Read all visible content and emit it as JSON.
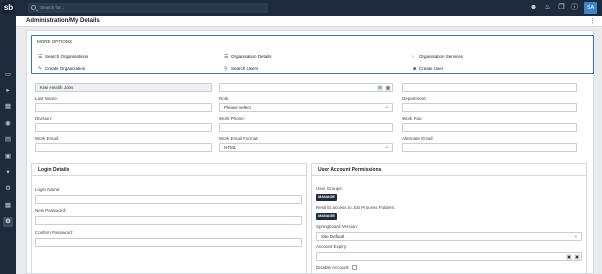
{
  "topbar": {
    "logo": "sb",
    "search_placeholder": "Search for...",
    "icons": [
      "user-add-icon",
      "bell-icon",
      "windows-icon",
      "help-icon"
    ],
    "avatar_initials": "SA"
  },
  "sidebar": {
    "icons": [
      "display-icon",
      "megaphone-icon",
      "folder-icon",
      "users-icon",
      "inbox-icon",
      "calendar-icon",
      "pin-icon",
      "gear-icon",
      "chart-icon",
      "settings-icon"
    ]
  },
  "page": {
    "title": "Administration/My Details"
  },
  "more_options": {
    "title": "MORE OPTIONS",
    "items": [
      {
        "label": "Search Organisations",
        "icon": "search-list-icon"
      },
      {
        "label": "Organisation Details",
        "icon": "list-icon"
      },
      {
        "label": "Organisation Services",
        "icon": "chevron-right-icon"
      },
      {
        "label": "Create Organization",
        "icon": "create-icon"
      },
      {
        "label": "Search Users",
        "icon": "search-users-icon"
      },
      {
        "label": "Create User",
        "icon": "user-add-icon"
      }
    ]
  },
  "details": {
    "org_value": "Kiwi Health Jobs",
    "last_name_label": "Last Name:",
    "role_label": "Role:",
    "role_value": "Please select",
    "department_label": "Department:",
    "division_label": "Division:",
    "work_phone_label": "Work Phone:",
    "work_fax_label": "Work Fax:",
    "work_email_label": "Work Email:",
    "work_email_format_label": "Work Email Format:",
    "work_email_format_value": "HTML",
    "alternate_email_label": "Alternate Email:"
  },
  "login": {
    "title": "Login Details",
    "login_name_label": "Login Name:",
    "new_password_label": "New Password:",
    "confirm_password_label": "Confirm Password:"
  },
  "permissions": {
    "title": "User Account Permissions",
    "user_groups_label": "User Groups:",
    "manage_label": "MANAGE",
    "restrict_label": "Restrict access to Job Process Folders:",
    "springboard_version_label": "Springboard Version:",
    "springboard_version_value": "Site Default",
    "account_expiry_label": "Account Expiry:",
    "disable_account_label": "Disable Account:"
  }
}
